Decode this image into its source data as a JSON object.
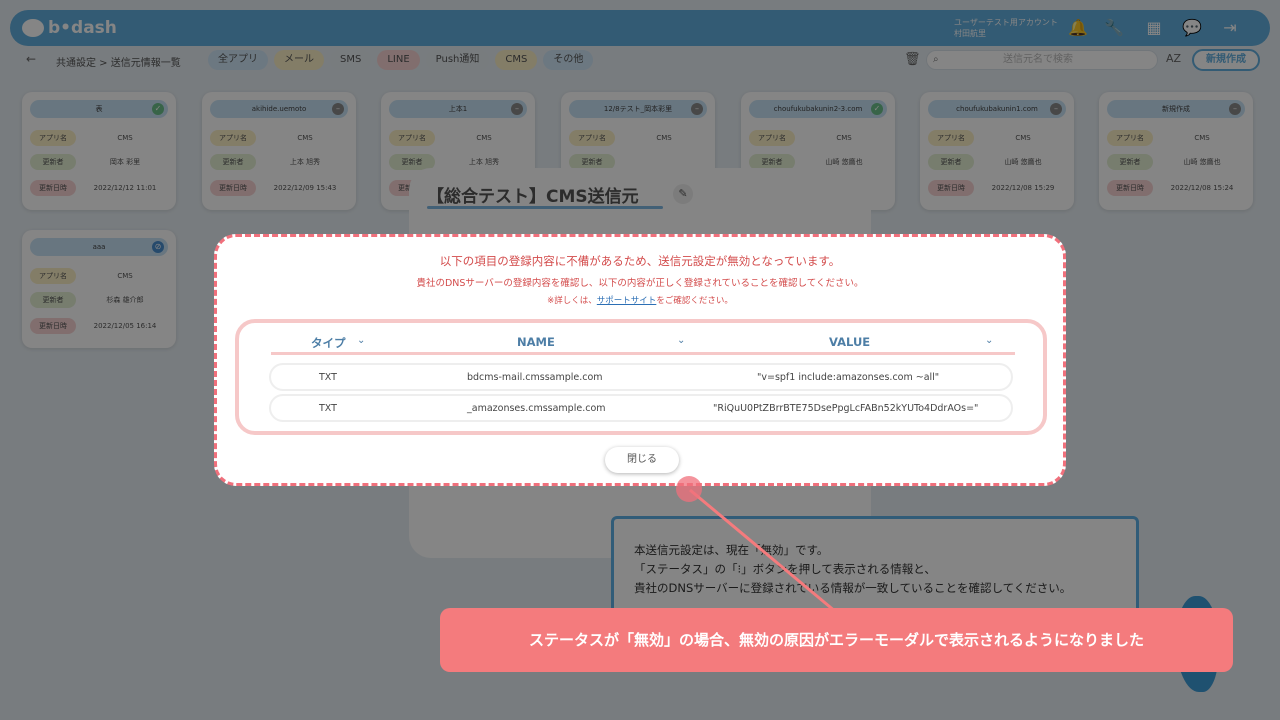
{
  "header": {
    "logo_text": "b•dash",
    "user_line1": "ユーザーテスト用アカウント",
    "user_line2": "村田航里",
    "icons": [
      "bell-icon",
      "wrench-icon",
      "grid-icon",
      "chat-icon",
      "logout-icon"
    ]
  },
  "subbar": {
    "breadcrumb": "共通設定 > 送信元情報一覧",
    "filters": [
      {
        "label": "全アプリ",
        "color": "#cfe6f7"
      },
      {
        "label": "メール",
        "color": "#fbefc5"
      },
      {
        "label": "SMS",
        "color": "#e6eef2"
      },
      {
        "label": "LINE",
        "color": "#f7d4d4"
      },
      {
        "label": "Push通知",
        "color": "#e6eef2"
      },
      {
        "label": "CMS",
        "color": "#fbefc5"
      },
      {
        "label": "その他",
        "color": "#cfe6f7"
      }
    ],
    "search_placeholder": "送信元名で検索",
    "new_button": "新規作成"
  },
  "labels": {
    "app": "アプリ名",
    "updater": "更新者",
    "updated": "更新日時"
  },
  "cards": [
    {
      "title": "表",
      "status": "check",
      "app": "CMS",
      "updater": "岡本 彩里",
      "date": "2022/12/12 11:01"
    },
    {
      "title": "akihide.uemoto",
      "status": "minus",
      "app": "CMS",
      "updater": "上本 旭秀",
      "date": "2022/12/09 15:43"
    },
    {
      "title": "上本1",
      "status": "minus",
      "app": "CMS",
      "updater": "上本 旭秀",
      "date": ""
    },
    {
      "title": "12/8テスト_岡本彩里",
      "status": "minus",
      "app": "CMS",
      "updater": "",
      "date": ""
    },
    {
      "title": "choufukubakunin2-3.com",
      "status": "check",
      "app": "CMS",
      "updater": "山崎 悠鷹也",
      "date": ""
    },
    {
      "title": "choufukubakunin1.com",
      "status": "minus",
      "app": "CMS",
      "updater": "山崎 悠鷹也",
      "date": "2022/12/08 15:29"
    },
    {
      "title": "新規作成",
      "status": "minus",
      "app": "CMS",
      "updater": "山崎 悠鷹也",
      "date": "2022/12/08 15:24"
    },
    {
      "title": "aaa",
      "status": "blocked",
      "app": "CMS",
      "updater": "杉森 雄介郎",
      "date": "2022/12/05 16:14"
    }
  ],
  "panel": {
    "title": "【総合テスト】CMS送信元"
  },
  "help": {
    "line1": "本送信元設定は、現在「無効」です。",
    "line2": "「ステータス」の「⁝」ボタンを押して表示される情報と、",
    "line3": "貴社のDNSサーバーに登録されている情報が一致していることを確認してください。"
  },
  "modal": {
    "line1": "以下の項目の登録内容に不備があるため、送信元設定が無効となっています。",
    "line2": "貴社のDNSサーバーの登録内容を確認し、以下の内容が正しく登録されていることを確認してください。",
    "line3_pre": "※詳しくは、",
    "line3_link": "サポートサイト",
    "line3_post": "をご確認ください。",
    "columns": [
      "タイプ",
      "NAME",
      "VALUE"
    ],
    "rows": [
      {
        "type": "TXT",
        "name": "bdcms-mail.cmssample.com",
        "value": "\"v=spf1 include:amazonses.com ~all\""
      },
      {
        "type": "TXT",
        "name": "_amazonses.cmssample.com",
        "value": "\"RiQuU0PtZBrrBTE75DsePpgLcFABn52kYUTo4DdrAOs=\""
      }
    ],
    "close": "閉じる"
  },
  "banner": "ステータスが「無効」の場合、無効の原因がエラーモーダルで表示されるようになりました"
}
